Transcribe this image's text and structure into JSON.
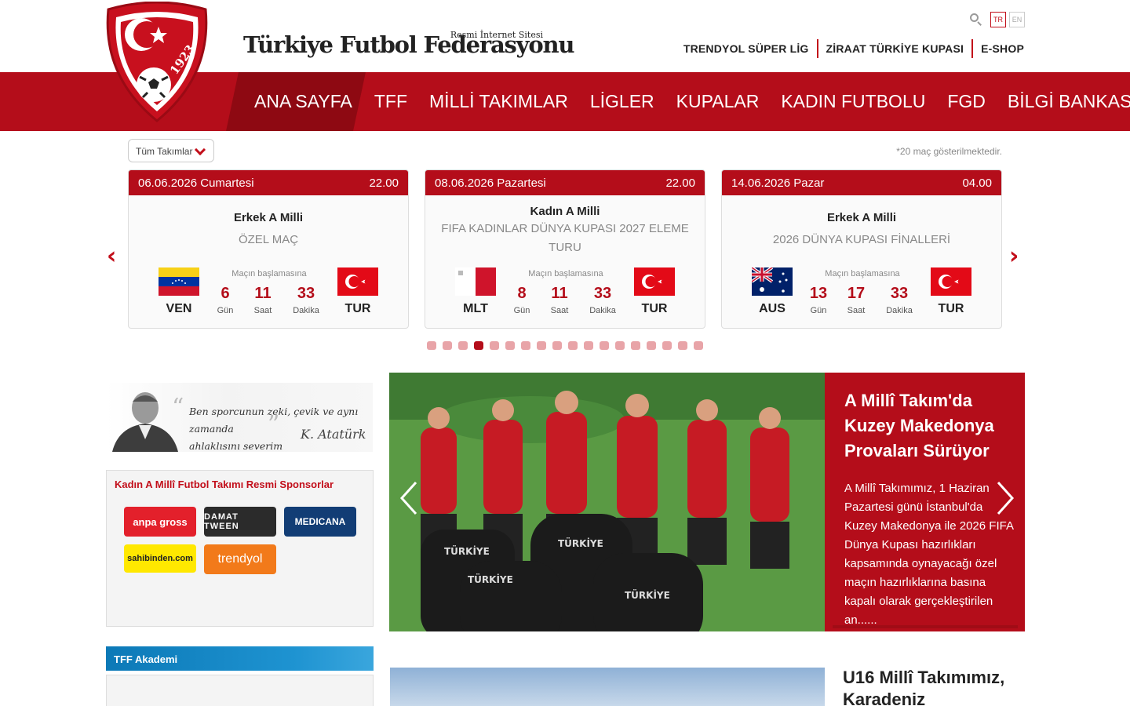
{
  "brand": {
    "subtitle": "Resmi İnternet Sitesi",
    "name": "Türkiye Futbol Federasyonu",
    "logo_year": "1923"
  },
  "tools": {
    "lang_tr": "TR",
    "lang_en": "EN"
  },
  "toplinks": [
    "TRENDYOL SÜPER LİG",
    "ZİRAAT TÜRKİYE KUPASI",
    "E-SHOP"
  ],
  "nav": [
    "ANA SAYFA",
    "TFF",
    "MİLLİ TAKIMLAR",
    "LİGLER",
    "KUPALAR",
    "KADIN FUTBOLU",
    "FGD",
    "BİLGİ BANKASI"
  ],
  "fixtures": {
    "filter_label": "Tüm Takımlar",
    "note": "*20 maç gösterilmektedir.",
    "countdown_label": "Maçın başlamasına",
    "unit_day": "Gün",
    "unit_hour": "Saat",
    "unit_min": "Dakika",
    "cards": [
      {
        "date": "06.06.2026 Cumartesi",
        "time": "22.00",
        "team": "Erkek A Milli",
        "competition": "ÖZEL MAÇ",
        "home": "VEN",
        "away": "TUR",
        "days": "6",
        "hours": "11",
        "mins": "33"
      },
      {
        "date": "08.06.2026 Pazartesi",
        "time": "22.00",
        "team": "Kadın A Milli",
        "competition": "FIFA KADINLAR DÜNYA KUPASI 2027 ELEME TURU",
        "home": "MLT",
        "away": "TUR",
        "days": "8",
        "hours": "11",
        "mins": "33"
      },
      {
        "date": "14.06.2026 Pazar",
        "time": "04.00",
        "team": "Erkek A Milli",
        "competition": "2026 DÜNYA KUPASI FİNALLERİ",
        "home": "AUS",
        "away": "TUR",
        "days": "13",
        "hours": "17",
        "mins": "33"
      }
    ],
    "pager_total": 18,
    "pager_active": 4
  },
  "quote": {
    "line1": "Ben sporcunun zeki, çevik ve aynı zamanda",
    "line2": "ahlaklısını severim",
    "signature": "K. Atatürk"
  },
  "sponsors": {
    "title": "Kadın A Millî Futbol Takımı Resmi Sponsorlar",
    "items": [
      {
        "name": "anpa gross",
        "color": "#e3202b",
        "text_color": "#ffffff"
      },
      {
        "name": "DAMAT TWEEN",
        "color": "#2b2b2b",
        "text_color": "#ffffff"
      },
      {
        "name": "MEDICANA",
        "color": "#123d75",
        "text_color": "#ffffff"
      },
      {
        "name": "sahibinden.com",
        "color": "#ffe800",
        "text_color": "#222222"
      },
      {
        "name": "trendyol",
        "color": "#f27a1a",
        "text_color": "#ffffff"
      }
    ]
  },
  "akademi": {
    "title": "TFF Akademi"
  },
  "headline": {
    "title": "A Millî Takım'da Kuzey Makedonya Provaları Sürüyor",
    "body": "A Millî Takımımız, 1 Haziran Pazartesi günü İstanbul'da Kuzey Makedonya ile 2026 FIFA Dünya Kupası hazırlıkları kapsamında oynayacağı özel maçın hazırlıklarına basına kapalı olarak gerçekleştirilen an......"
  },
  "news2": {
    "title": "U16 Millî Takımımız, Karadeniz"
  },
  "colors": {
    "brand_red": "#b40d1a",
    "active_red": "#8e0912"
  }
}
